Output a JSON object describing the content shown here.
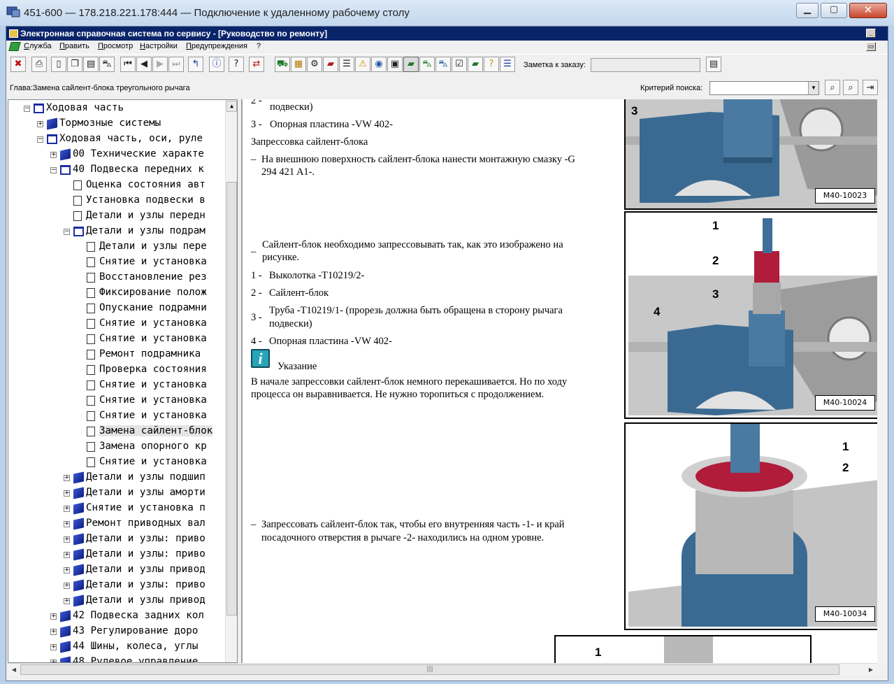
{
  "window": {
    "title": "451-600 — 178.218.221.178:444 — Подключение к удаленному рабочему столу",
    "minimize": "▁",
    "maximize": "▢",
    "close": "✕"
  },
  "app": {
    "title": "Электронная справочная система по сервису - [Руководство по ремонту]",
    "menu": [
      "Служба",
      "Править",
      "Просмотр",
      "Настройки",
      "Предупреждения",
      "?"
    ]
  },
  "toolbar": {
    "order_note_label": "Заметка к заказу:",
    "order_note_value": "",
    "icons": [
      "exit-icon",
      "print-icon",
      "new-page-icon",
      "copy-icon",
      "document-icon",
      "car-icon",
      "first-icon",
      "prev-icon",
      "next-icon",
      "last-icon",
      "up-level-icon",
      "info-icon",
      "help-icon",
      "sync-icon",
      "vehicle-icon",
      "calculator-icon",
      "engine-icon",
      "book-red-icon",
      "list-icon",
      "warning-icon",
      "globe-icon",
      "disk-icon",
      "green-book-icon",
      "green-car-icon",
      "blue-car-icon",
      "checklist-icon",
      "books-icon",
      "question-book-icon",
      "layers-icon",
      "notes-icon"
    ]
  },
  "chapter": {
    "label": "Глава:Замена сайлент-блока треугольного рычага",
    "search_label": "Критерий поиска:",
    "search_value": ""
  },
  "tree": [
    {
      "label": "Ходовая часть",
      "icon": "open",
      "exp": "−"
    },
    {
      "label": "Тормозные системы",
      "icon": "book",
      "exp": "+"
    },
    {
      "label": "Ходовая часть, оси, руле",
      "icon": "open",
      "exp": "−"
    },
    {
      "label": "00 Технические характе",
      "icon": "book",
      "exp": "+"
    },
    {
      "label": "40 Подвеска передних к",
      "icon": "open",
      "exp": "−"
    },
    {
      "label": "Оценка состояния авт",
      "icon": "page",
      "exp": ""
    },
    {
      "label": "Установка подвески в",
      "icon": "page",
      "exp": ""
    },
    {
      "label": "Детали и узлы передн",
      "icon": "page",
      "exp": ""
    },
    {
      "label": "Детали и узлы подрам",
      "icon": "open",
      "exp": "−"
    },
    {
      "label": "Детали и узлы пере",
      "icon": "page",
      "exp": ""
    },
    {
      "label": "Снятие и установка",
      "icon": "page",
      "exp": ""
    },
    {
      "label": "Восстановление рез",
      "icon": "page",
      "exp": ""
    },
    {
      "label": "Фиксирование полож",
      "icon": "page",
      "exp": ""
    },
    {
      "label": "Опускание подрамни",
      "icon": "page",
      "exp": ""
    },
    {
      "label": "Снятие и установка",
      "icon": "page",
      "exp": ""
    },
    {
      "label": "Снятие и установка",
      "icon": "page",
      "exp": ""
    },
    {
      "label": "Ремонт подрамника",
      "icon": "page",
      "exp": ""
    },
    {
      "label": "Проверка состояния",
      "icon": "page",
      "exp": ""
    },
    {
      "label": "Снятие и установка",
      "icon": "page",
      "exp": ""
    },
    {
      "label": "Снятие и установка",
      "icon": "page",
      "exp": ""
    },
    {
      "label": "Снятие и установка",
      "icon": "page",
      "exp": ""
    },
    {
      "label": "Замена сайлент-блок",
      "icon": "page",
      "exp": "",
      "selected": true
    },
    {
      "label": "Замена опорного кр",
      "icon": "page",
      "exp": ""
    },
    {
      "label": "Снятие и установка",
      "icon": "page",
      "exp": ""
    },
    {
      "label": "Детали и узлы подшип",
      "icon": "book",
      "exp": "+"
    },
    {
      "label": "Детали и узлы аморти",
      "icon": "book",
      "exp": "+"
    },
    {
      "label": "Снятие и установка п",
      "icon": "book",
      "exp": "+"
    },
    {
      "label": "Ремонт приводных вал",
      "icon": "book",
      "exp": "+"
    },
    {
      "label": "Детали и узлы: приво",
      "icon": "book",
      "exp": "+"
    },
    {
      "label": "Детали и узлы: приво",
      "icon": "book",
      "exp": "+"
    },
    {
      "label": "Детали и узлы привод",
      "icon": "book",
      "exp": "+"
    },
    {
      "label": "Детали и узлы: приво",
      "icon": "book",
      "exp": "+"
    },
    {
      "label": "Детали и узлы привод",
      "icon": "book",
      "exp": "+"
    },
    {
      "label": "42 Подвеска задних кол",
      "icon": "book",
      "exp": "+"
    },
    {
      "label": "43 Регулирование доро",
      "icon": "book",
      "exp": "+"
    },
    {
      "label": "44 Шины, колеса, углы",
      "icon": "book",
      "exp": "+"
    },
    {
      "label": "48 Рулевое управление",
      "icon": "book",
      "exp": "+"
    }
  ],
  "content": {
    "t1_num": "2 -",
    "t1_a": "подвески)",
    "t2_num": "3 -",
    "t2": "Опорная пластина -VW 402-",
    "t3": "Запрессовка сайлент-блока",
    "t4_dash": "–",
    "t4a": "На внешнюю поверхность сайлент-блока нанести монтажную смазку -G",
    "t4b": "294 421 A1-.",
    "t5_dash": "_",
    "t5a": "Сайлент-блок необходимо запрессовывать так, как это изображено на",
    "t5b": "рисунке.",
    "l1_num": "1 -",
    "l1": "Выколотка -T10219/2-",
    "l2_num": "2 -",
    "l2": "Сайлент-блок",
    "l3_num": "3 -",
    "l3a": "Труба -T10219/1- (прорезь должна быть обращена в сторону рычага",
    "l3b": "подвески)",
    "l4_num": "4 -",
    "l4": "Опорная пластина -VW 402-",
    "note_icon": "i",
    "note_title": "Указание",
    "note_a": "В начале запрессовки сайлент-блок немного перекашивается. Но по ходу",
    "note_b": "процесса он выравнивается. Не нужно торопиться с продолжением.",
    "t6_dash": "–",
    "t6a": "Запрессовать сайлент-блок так, чтобы его внутренняя часть -1- и край",
    "t6b": "посадочного отверстия в рычаге -2- находились на одном уровне."
  },
  "figures": {
    "f1_code": "M40-10023",
    "f1_callout": "3",
    "f2_code": "M40-10024",
    "f2_callouts": [
      "1",
      "2",
      "3",
      "4"
    ],
    "f3_code": "M40-10034",
    "f3_callouts": [
      "1",
      "2"
    ],
    "f4_callout": "1"
  },
  "scrollbar": {
    "grip": "|||",
    "left": "◀",
    "right": "▶",
    "up": "▲",
    "down": "▼"
  },
  "colors": {
    "titlebar": "#0a246a",
    "selection": "#e4e4e4",
    "tool_blue": "#3b6e96",
    "bushing_red": "#b01c3a"
  }
}
